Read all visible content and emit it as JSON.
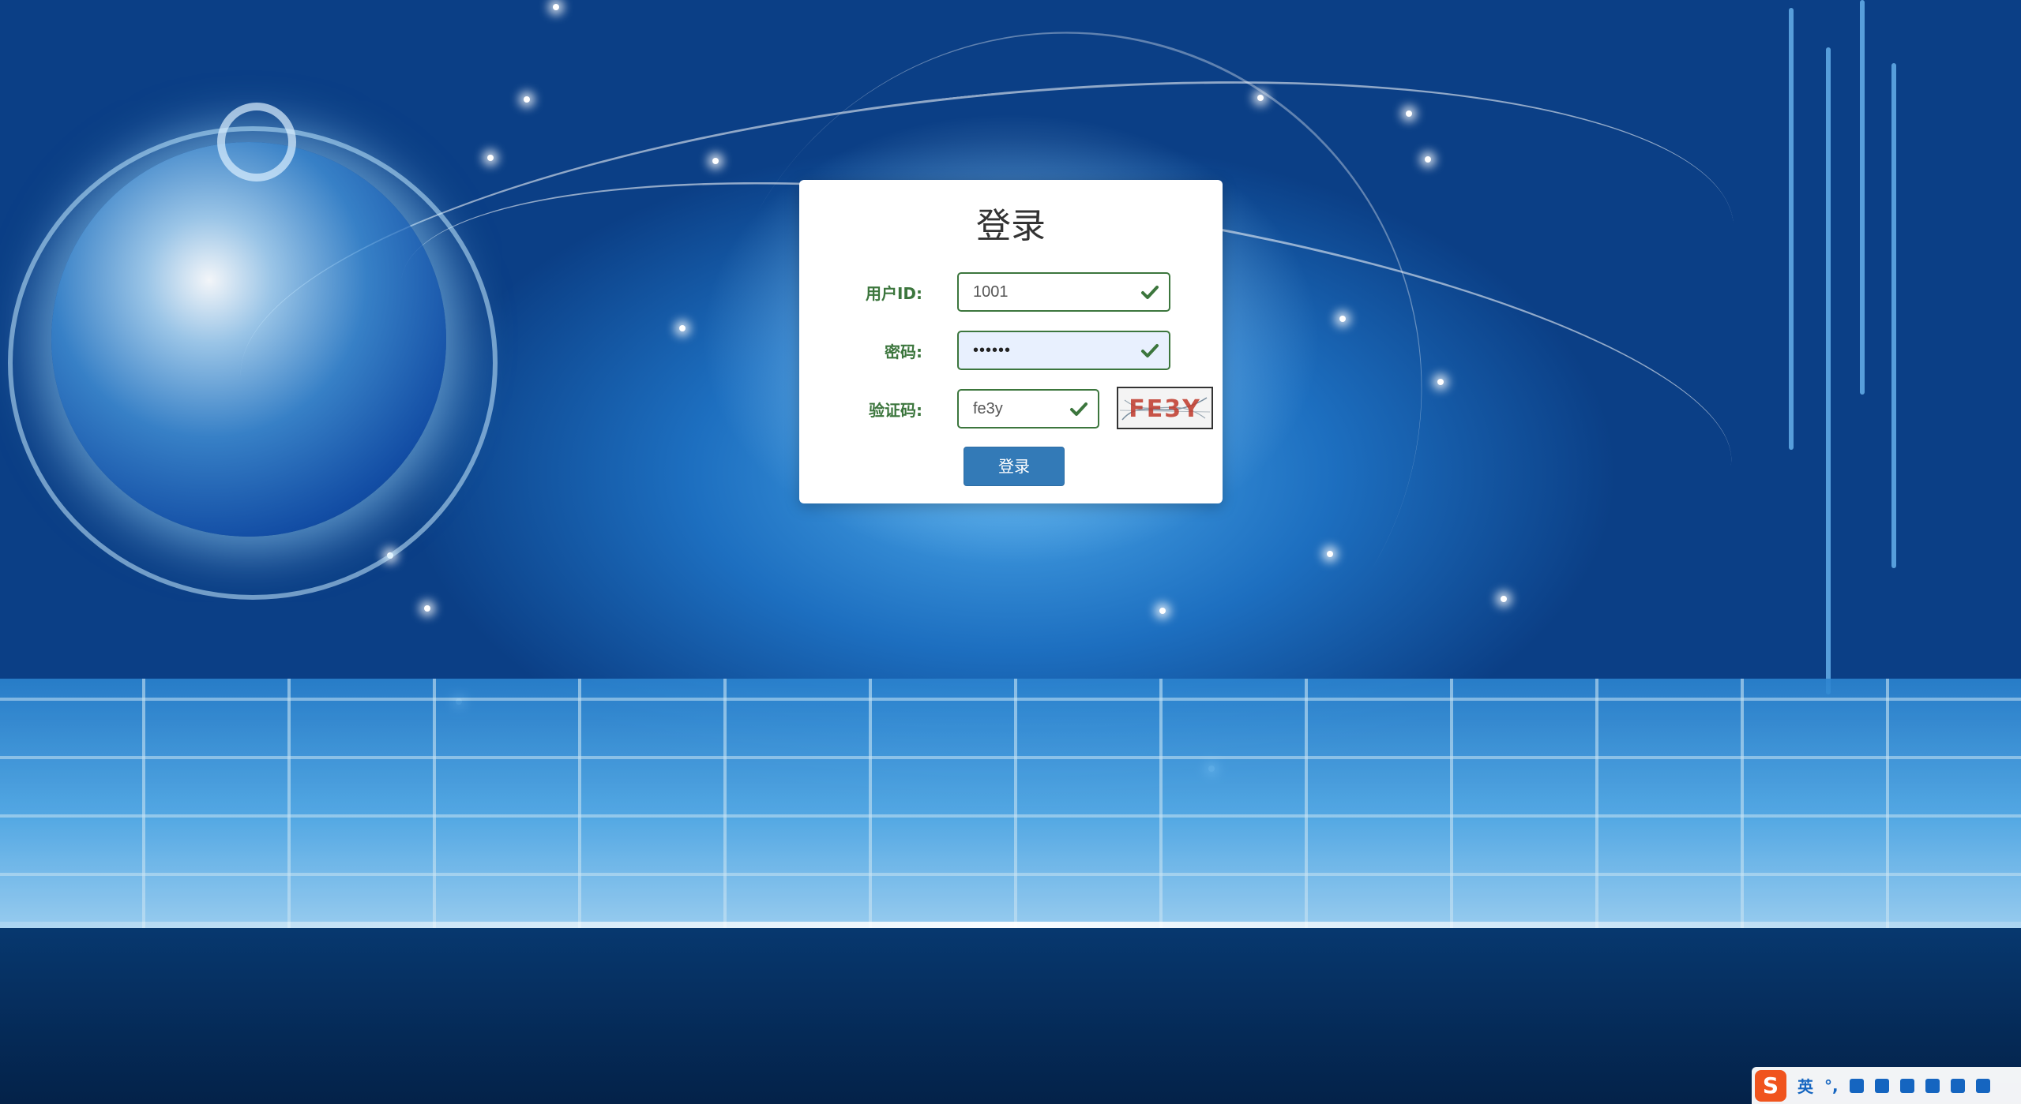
{
  "login": {
    "title": "登录",
    "user_id_label": "用户ID:",
    "user_id_value": "1001",
    "password_label": "密码:",
    "password_value": "••••••",
    "captcha_label": "验证码:",
    "captcha_value": "fe3y",
    "captcha_image_text": "FE3Y",
    "submit_label": "登录"
  },
  "ime_toolbar": {
    "logo": "S",
    "mode": "英",
    "punct": "°,",
    "icons": [
      "microphone-icon",
      "keyboard-icon",
      "skin-icon",
      "gamepad-icon",
      "apps-icon",
      "settings-icon"
    ]
  },
  "colors": {
    "valid_green": "#3c763d",
    "button_blue": "#337ab7",
    "ime_brand": "#f0541e"
  }
}
